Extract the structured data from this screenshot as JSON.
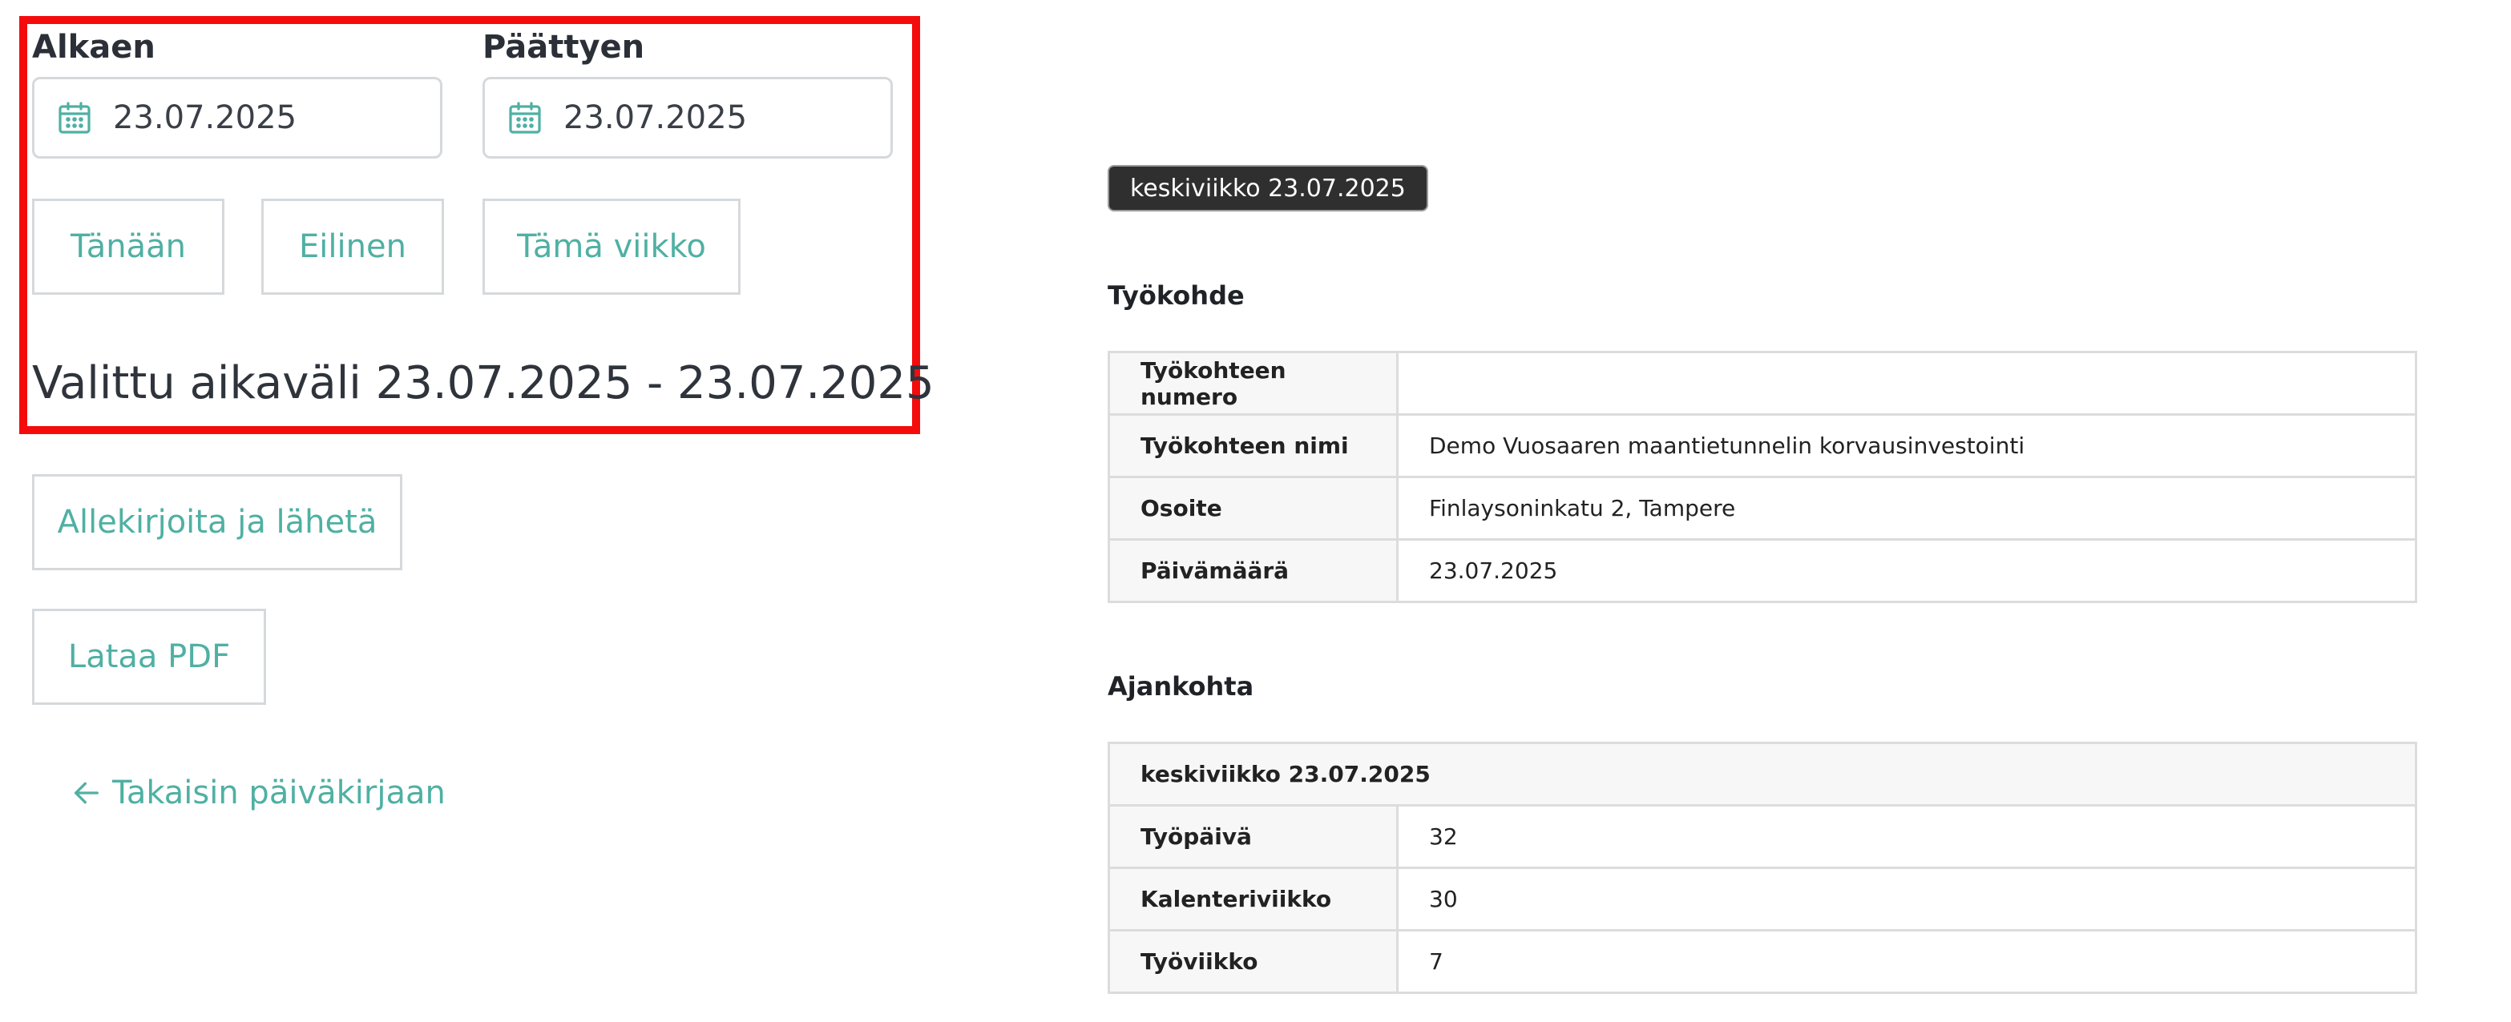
{
  "date_range": {
    "start_label": "Alkaen",
    "start_value": "23.07.2025",
    "end_label": "Päättyen",
    "end_value": "23.07.2025",
    "quick_buttons": [
      "Tänään",
      "Eilinen",
      "Tämä viikko"
    ],
    "selected_range_text": "Valittu aikaväli 23.07.2025 - 23.07.2025"
  },
  "actions": {
    "sign_and_send": "Allekirjoita ja lähetä",
    "download_pdf": "Lataa PDF",
    "back_link": "Takaisin päiväkirjaan"
  },
  "report": {
    "date_chip": "keskiviikko 23.07.2025",
    "worksite": {
      "title": "Työkohde",
      "rows": [
        {
          "key": "Työkohteen numero",
          "value": ""
        },
        {
          "key": "Työkohteen nimi",
          "value": "Demo Vuosaaren maantietunnelin korvausinvestointi"
        },
        {
          "key": "Osoite",
          "value": "Finlaysoninkatu 2, Tampere"
        },
        {
          "key": "Päivämäärä",
          "value": "23.07.2025"
        }
      ]
    },
    "timing": {
      "title": "Ajankohta",
      "header": "keskiviikko 23.07.2025",
      "rows": [
        {
          "key": "Työpäivä",
          "value": "32"
        },
        {
          "key": "Kalenteriviikko",
          "value": "30"
        },
        {
          "key": "Työviikko",
          "value": "7"
        }
      ]
    }
  },
  "colors": {
    "accent": "#4fb0a3",
    "highlight": "#f40c0c",
    "border": "#d6d9dc"
  },
  "icons": {
    "date_input": "calendar-icon",
    "back": "arrow-left-icon"
  }
}
